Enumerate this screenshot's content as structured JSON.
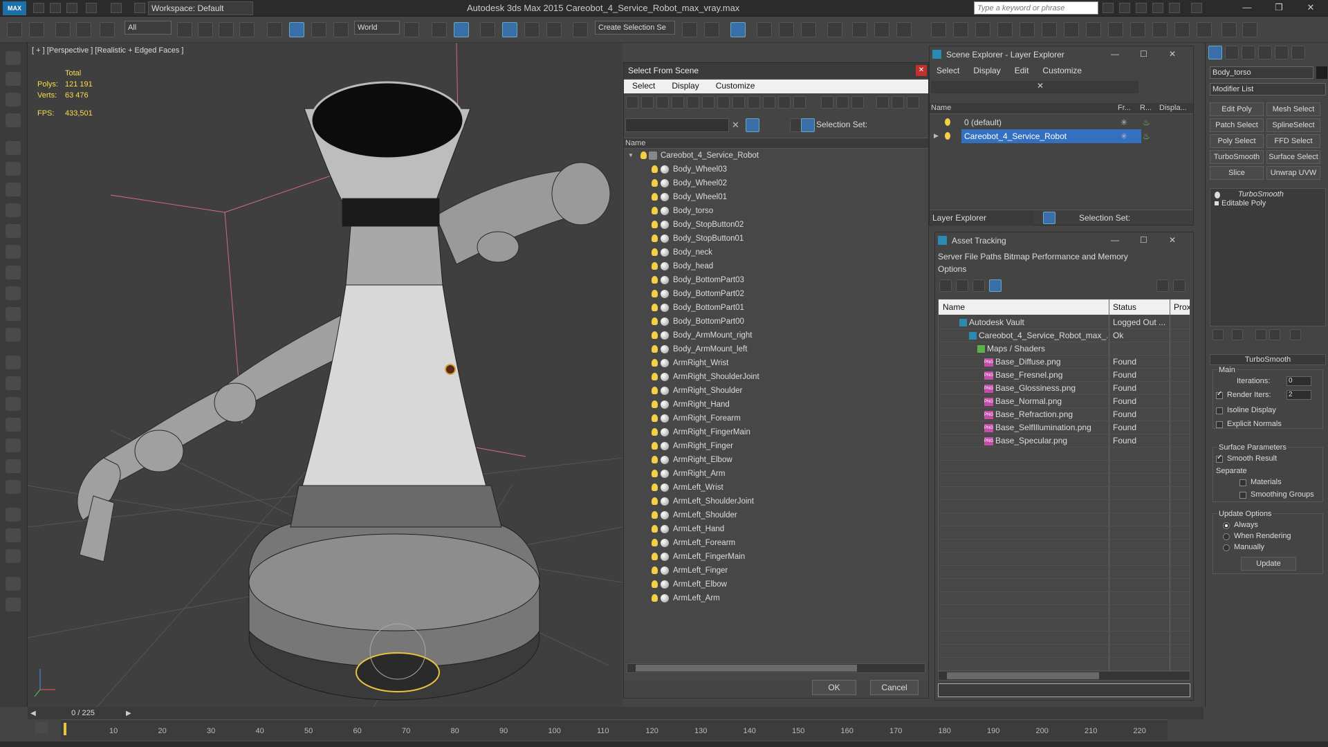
{
  "titlebar": {
    "workspace": "Workspace: Default",
    "app_title": "Autodesk 3ds Max  2015      Careobot_4_Service_Robot_max_vray.max",
    "search_placeholder": "Type a keyword or phrase"
  },
  "toolbar": {
    "filter_select": "All",
    "coord_select": "World",
    "selection_set": "Create Selection Se"
  },
  "viewport": {
    "label": "[ + ] [Perspective ] [Realistic + Edged Faces ]",
    "stats_total": "Total",
    "polys_label": "Polys:",
    "polys_value": "121 191",
    "verts_label": "Verts:",
    "verts_value": "63 476",
    "fps_label": "FPS:",
    "fps_value": "433,501"
  },
  "select_from_scene": {
    "title": "Select From Scene",
    "menu": [
      "Select",
      "Display",
      "Customize"
    ],
    "selection_set_label": "Selection Set:",
    "column_name": "Name",
    "root": "Careobot_4_Service_Robot",
    "items": [
      "Body_Wheel03",
      "Body_Wheel02",
      "Body_Wheel01",
      "Body_torso",
      "Body_StopButton02",
      "Body_StopButton01",
      "Body_neck",
      "Body_head",
      "Body_BottomPart03",
      "Body_BottomPart02",
      "Body_BottomPart01",
      "Body_BottomPart00",
      "Body_ArmMount_right",
      "Body_ArmMount_left",
      "ArmRight_Wrist",
      "ArmRight_ShoulderJoint",
      "ArmRight_Shoulder",
      "ArmRight_Hand",
      "ArmRight_Forearm",
      "ArmRight_FingerMain",
      "ArmRight_Finger",
      "ArmRight_Elbow",
      "ArmRight_Arm",
      "ArmLeft_Wrist",
      "ArmLeft_ShoulderJoint",
      "ArmLeft_Shoulder",
      "ArmLeft_Hand",
      "ArmLeft_Forearm",
      "ArmLeft_FingerMain",
      "ArmLeft_Finger",
      "ArmLeft_Elbow",
      "ArmLeft_Arm"
    ],
    "ok": "OK",
    "cancel": "Cancel"
  },
  "scene_explorer": {
    "title": "Scene Explorer - Layer Explorer",
    "menu": [
      "Select",
      "Display",
      "Edit",
      "Customize"
    ],
    "col_name": "Name",
    "col_fr": "Fr...",
    "col_r": "R...",
    "col_disp": "Displa...",
    "layers": [
      "0 (default)",
      "Careobot_4_Service_Robot"
    ],
    "footer_select": "Layer Explorer",
    "selection_set": "Selection Set:"
  },
  "asset_tracking": {
    "title": "Asset Tracking",
    "menu1": "Server   File   Paths   Bitmap Performance and Memory",
    "menu2": "Options",
    "col_name": "Name",
    "col_status": "Status",
    "col_prox": "Prox",
    "rows": [
      {
        "name": "Autodesk Vault",
        "status": "Logged Out ..."
      },
      {
        "name": "Careobot_4_Service_Robot_max_...",
        "status": "Ok"
      },
      {
        "name": "Maps / Shaders",
        "status": ""
      },
      {
        "name": "Base_Diffuse.png",
        "status": "Found"
      },
      {
        "name": "Base_Fresnel.png",
        "status": "Found"
      },
      {
        "name": "Base_Glossiness.png",
        "status": "Found"
      },
      {
        "name": "Base_Normal.png",
        "status": "Found"
      },
      {
        "name": "Base_Refraction.png",
        "status": "Found"
      },
      {
        "name": "Base_SelfIllumination.png",
        "status": "Found"
      },
      {
        "name": "Base_Specular.png",
        "status": "Found"
      }
    ]
  },
  "command_panel": {
    "object_name": "Body_torso",
    "modifier_list": "Modifier List",
    "buttons": [
      "Edit Poly",
      "Mesh Select",
      "Patch Select",
      "SplineSelect",
      "Poly Select",
      "FFD Select",
      "TurboSmooth",
      "Surface Select",
      "Slice",
      "Unwrap UVW"
    ],
    "stack": [
      "TurboSmooth",
      "Editable Poly"
    ],
    "rollout_title": "TurboSmooth",
    "main_label": "Main",
    "iterations_label": "Iterations:",
    "iterations_value": "0",
    "render_iters_label": "Render Iters:",
    "render_iters_value": "2",
    "isoline": "Isoline Display",
    "explicit_normals": "Explicit Normals",
    "surface_params": "Surface Parameters",
    "smooth_result": "Smooth Result",
    "separate": "Separate",
    "materials": "Materials",
    "smoothing_groups": "Smoothing Groups",
    "update_options": "Update Options",
    "always": "Always",
    "when_rendering": "When Rendering",
    "manually": "Manually",
    "update_button": "Update"
  },
  "timeline": {
    "frame": "0 / 225",
    "ticks": [
      "10",
      "20",
      "30",
      "40",
      "50",
      "60",
      "70",
      "80",
      "90",
      "100",
      "110",
      "120",
      "130",
      "140",
      "150",
      "160",
      "170",
      "180",
      "190",
      "200",
      "210",
      "220"
    ]
  },
  "colors": {
    "accent": "#3a6ea8",
    "selected_row": "#3470c0",
    "stats": "#ffdc4a"
  }
}
